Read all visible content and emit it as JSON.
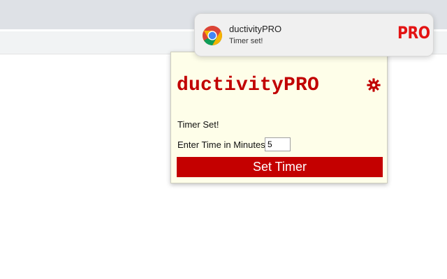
{
  "popup": {
    "title": "ductivityPRO",
    "status": "Timer Set!",
    "time_label": "Enter Time in Minutes",
    "time_value": "5",
    "button_label": "Set Timer",
    "settings_icon": "gear-icon"
  },
  "notification": {
    "title": "ductivityPRO",
    "body": "Timer set!",
    "badge": "PRO",
    "app_icon": "chrome-icon"
  },
  "colors": {
    "brand_red": "#c40000",
    "popup_bg": "#fefee9",
    "notification_bg": "#f0f0f0"
  }
}
